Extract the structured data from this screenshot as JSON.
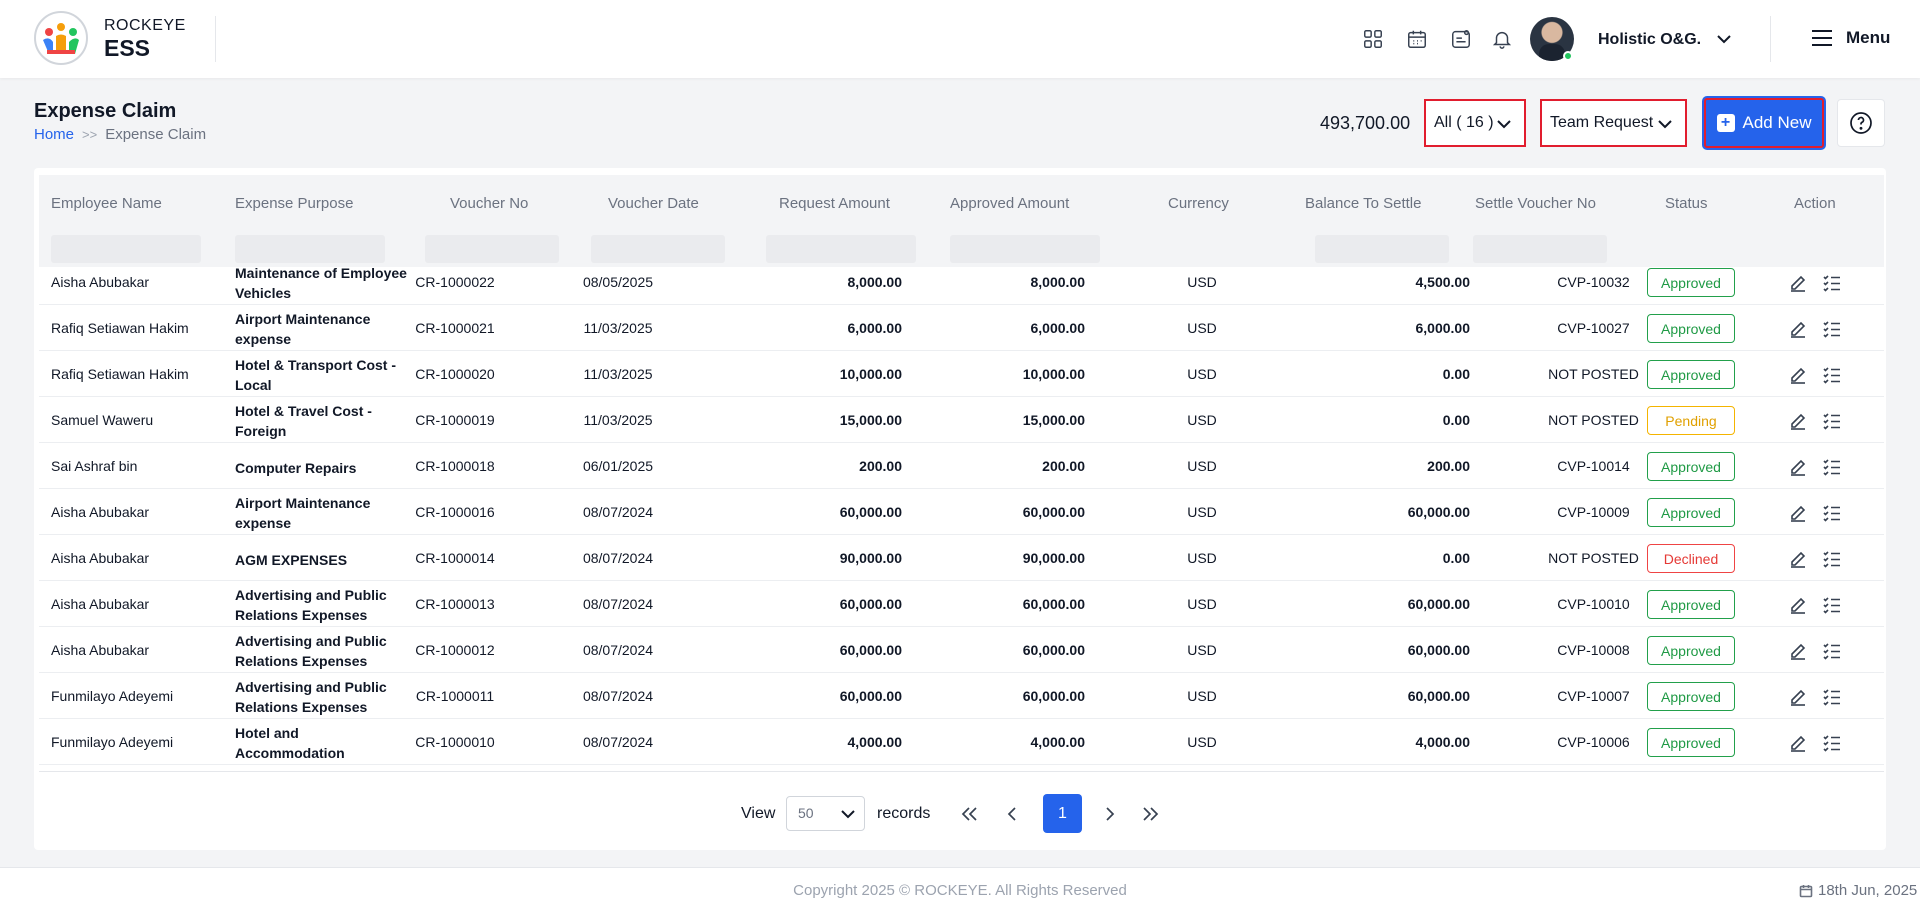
{
  "brand": {
    "line1": "ROCKEYE",
    "line2": "ESS"
  },
  "header": {
    "company": "Holistic O&G.",
    "menu_label": "Menu",
    "icons": [
      "apps-grid-icon",
      "calendar-icon",
      "notes-icon",
      "bell-icon"
    ]
  },
  "page": {
    "title": "Expense Claim",
    "breadcrumb": {
      "home": "Home",
      "current": "Expense Claim"
    },
    "total": "493,700.00",
    "filter_all": "All ( 16 )",
    "filter_request": "Team Request",
    "add_new": "Add New"
  },
  "table": {
    "headers": {
      "employee": "Employee Name",
      "purpose": "Expense Purpose",
      "voucher": "Voucher No",
      "date": "Voucher Date",
      "request": "Request Amount",
      "approved": "Approved Amount",
      "currency": "Currency",
      "balance": "Balance To Settle",
      "settle": "Settle Voucher No",
      "status": "Status",
      "action": "Action"
    },
    "rows": [
      {
        "employee": "Aisha Abubakar",
        "purpose": "Maintenance of Employee Vehicles",
        "voucher": "CR-1000022",
        "date": "08/05/2025",
        "request": "8,000.00",
        "approved": "8,000.00",
        "currency": "USD",
        "balance": "4,500.00",
        "settle": "CVP-10032",
        "status": "Approved"
      },
      {
        "employee": "Rafiq Setiawan Hakim",
        "purpose": "Airport Maintenance expense",
        "voucher": "CR-1000021",
        "date": "11/03/2025",
        "request": "6,000.00",
        "approved": "6,000.00",
        "currency": "USD",
        "balance": "6,000.00",
        "settle": "CVP-10027",
        "status": "Approved"
      },
      {
        "employee": "Rafiq Setiawan Hakim",
        "purpose": "Hotel & Transport Cost - Local",
        "voucher": "CR-1000020",
        "date": "11/03/2025",
        "request": "10,000.00",
        "approved": "10,000.00",
        "currency": "USD",
        "balance": "0.00",
        "settle": "NOT POSTED",
        "status": "Approved"
      },
      {
        "employee": "Samuel Waweru",
        "purpose": "Hotel & Travel Cost - Foreign",
        "voucher": "CR-1000019",
        "date": "11/03/2025",
        "request": "15,000.00",
        "approved": "15,000.00",
        "currency": "USD",
        "balance": "0.00",
        "settle": "NOT POSTED",
        "status": "Pending"
      },
      {
        "employee": "Sai Ashraf bin",
        "purpose": "Computer Repairs",
        "voucher": "CR-1000018",
        "date": "06/01/2025",
        "request": "200.00",
        "approved": "200.00",
        "currency": "USD",
        "balance": "200.00",
        "settle": "CVP-10014",
        "status": "Approved"
      },
      {
        "employee": "Aisha Abubakar",
        "purpose": "Airport Maintenance expense",
        "voucher": "CR-1000016",
        "date": "08/07/2024",
        "request": "60,000.00",
        "approved": "60,000.00",
        "currency": "USD",
        "balance": "60,000.00",
        "settle": "CVP-10009",
        "status": "Approved"
      },
      {
        "employee": "Aisha Abubakar",
        "purpose": "AGM EXPENSES",
        "voucher": "CR-1000014",
        "date": "08/07/2024",
        "request": "90,000.00",
        "approved": "90,000.00",
        "currency": "USD",
        "balance": "0.00",
        "settle": "NOT POSTED",
        "status": "Declined"
      },
      {
        "employee": "Aisha Abubakar",
        "purpose": "Advertising and Public Relations Expenses",
        "voucher": "CR-1000013",
        "date": "08/07/2024",
        "request": "60,000.00",
        "approved": "60,000.00",
        "currency": "USD",
        "balance": "60,000.00",
        "settle": "CVP-10010",
        "status": "Approved"
      },
      {
        "employee": "Aisha Abubakar",
        "purpose": "Advertising and Public Relations Expenses",
        "voucher": "CR-1000012",
        "date": "08/07/2024",
        "request": "60,000.00",
        "approved": "60,000.00",
        "currency": "USD",
        "balance": "60,000.00",
        "settle": "CVP-10008",
        "status": "Approved"
      },
      {
        "employee": "Funmilayo Adeyemi",
        "purpose": "Advertising and Public Relations Expenses",
        "voucher": "CR-1000011",
        "date": "08/07/2024",
        "request": "60,000.00",
        "approved": "60,000.00",
        "currency": "USD",
        "balance": "60,000.00",
        "settle": "CVP-10007",
        "status": "Approved"
      },
      {
        "employee": "Funmilayo Adeyemi",
        "purpose": "Hotel and Accommodation",
        "voucher": "CR-1000010",
        "date": "08/07/2024",
        "request": "4,000.00",
        "approved": "4,000.00",
        "currency": "USD",
        "balance": "4,000.00",
        "settle": "CVP-10006",
        "status": "Approved"
      }
    ]
  },
  "status_colors": {
    "Approved": {
      "border": "#22a04b",
      "text": "#1f9a45"
    },
    "Pending": {
      "border": "#f4b400",
      "text": "#e0a000"
    },
    "Declined": {
      "border": "#ef4444",
      "text": "#e53935"
    }
  },
  "pagination": {
    "view_label": "View",
    "page_size": "50",
    "records_label": "records",
    "current_page": "1"
  },
  "footer": {
    "copyright": "Copyright 2025 © ROCKEYE. All Rights Reserved",
    "date": "18th Jun, 2025"
  }
}
